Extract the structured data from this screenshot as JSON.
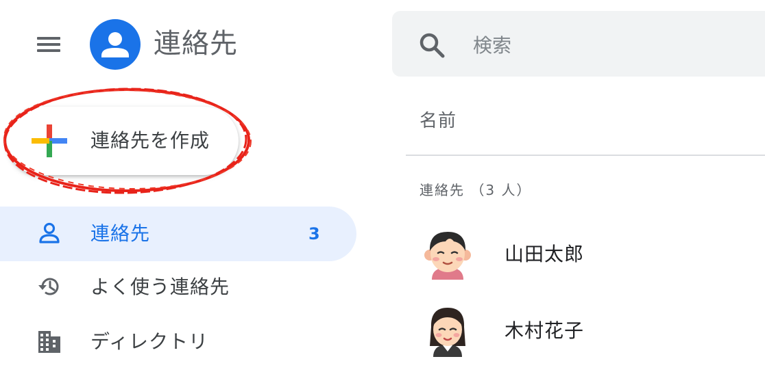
{
  "app": {
    "title": "連絡先",
    "logo_icon": "person-icon",
    "accent_color": "#1a73e8"
  },
  "header": {
    "menu_icon": "menu-icon"
  },
  "search": {
    "placeholder": "検索",
    "value": "",
    "icon": "search-icon"
  },
  "create_button": {
    "label": "連絡先を作成",
    "icon": "multicolor-plus-icon"
  },
  "sidebar": {
    "items": [
      {
        "label": "連絡先",
        "count": "3",
        "icon": "person-outline-icon",
        "active": true
      },
      {
        "label": "よく使う連絡先",
        "icon": "history-icon",
        "active": false
      },
      {
        "label": "ディレクトリ",
        "icon": "building-icon",
        "active": false
      }
    ]
  },
  "list": {
    "column_header": "名前",
    "section_label": "連絡先 （3 人）",
    "contacts": [
      {
        "name": "山田太郎",
        "avatar": "man-avatar"
      },
      {
        "name": "木村花子",
        "avatar": "woman-avatar"
      }
    ]
  }
}
